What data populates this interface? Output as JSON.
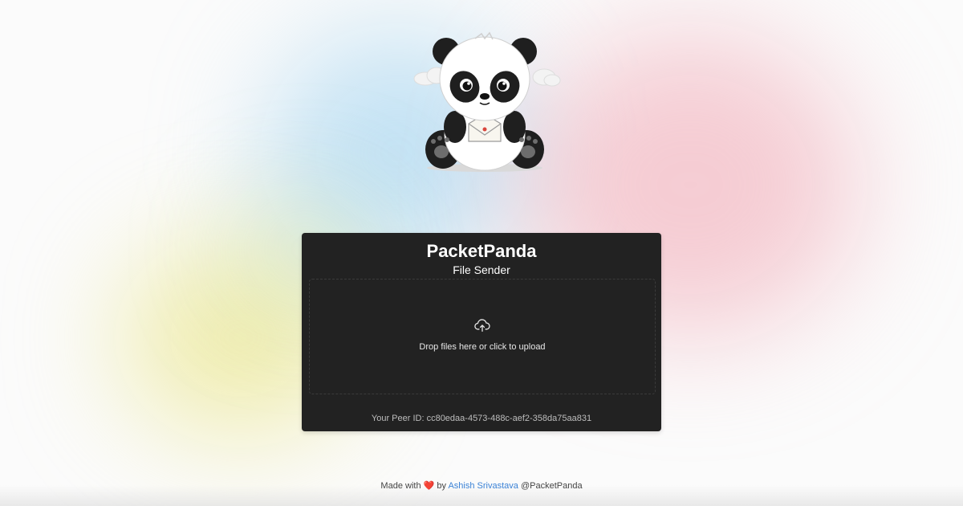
{
  "app": {
    "title": "PacketPanda",
    "subtitle": "File Sender"
  },
  "dropzone": {
    "icon": "upload-cloud-icon",
    "text": "Drop files here or click to upload"
  },
  "peer": {
    "label": "Your Peer ID: cc80edaa-4573-488c-aef2-358da75aa831"
  },
  "footer": {
    "made_with": "Made with",
    "heart": "❤️",
    "by": "by",
    "author": "Ashish Srivastava",
    "handle": "@PacketPanda"
  },
  "colors": {
    "card_bg": "#222222",
    "link": "#3b82d6",
    "heart": "#e0313a"
  },
  "mascot": {
    "icon": "panda-mascot"
  }
}
